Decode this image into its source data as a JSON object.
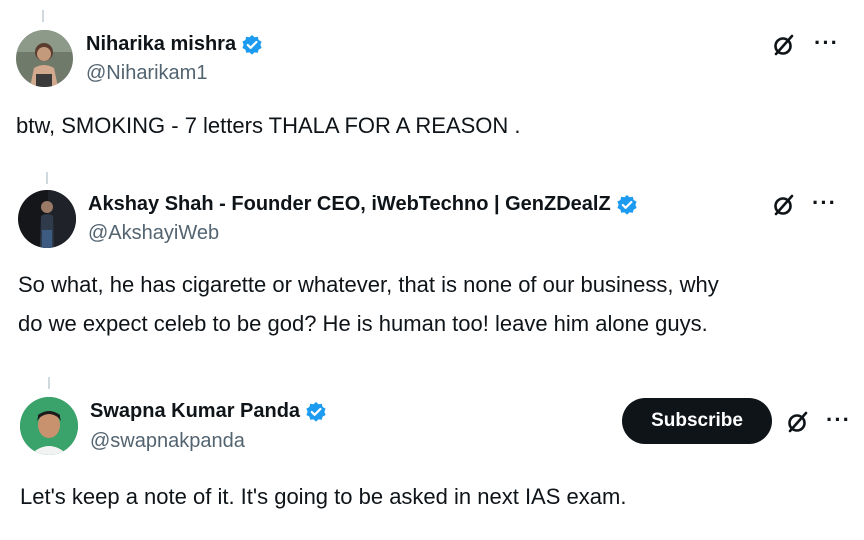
{
  "tweets": [
    {
      "name": "Niharika mishra",
      "handle": "@Niharikam1",
      "text": "btw, SMOKING - 7 letters THALA FOR A REASON ."
    },
    {
      "name": "Akshay Shah - Founder CEO, iWebTechno | GenZDealZ",
      "handle": "@AkshayiWeb",
      "text_line1": "So what, he has cigarette or whatever, that is none of our business, why",
      "text_line2": "do we expect celeb to be god? He is human too! leave him alone guys."
    },
    {
      "name": "Swapna Kumar Panda",
      "handle": "@swapnakpanda",
      "subscribe_label": "Subscribe",
      "text": "Let's keep a note of it. It's going to be asked in next IAS exam."
    }
  ],
  "more_glyph": "···",
  "colors": {
    "verified_blue": "#1d9bf0",
    "text": "#0f1419",
    "secondary": "#536471",
    "thread_line": "#cfd9de"
  },
  "icons": [
    "grok-icon",
    "more-icon",
    "verified-badge-icon"
  ]
}
